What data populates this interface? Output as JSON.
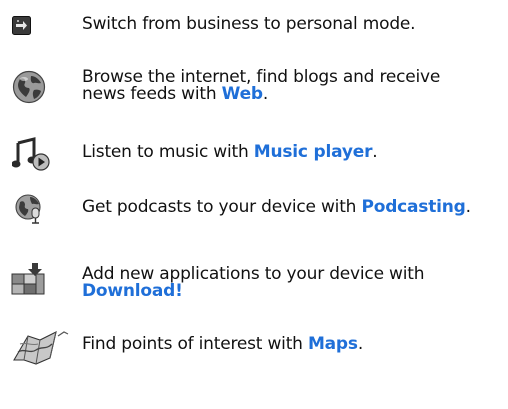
{
  "rows": [
    {
      "icon": "mode-switch-icon",
      "text": "Switch from business to personal mode."
    },
    {
      "icon": "globe-icon",
      "line1": "Browse the internet, find blogs and receive",
      "line2_prefix": "news feeds with ",
      "link": "Web",
      "suffix": "."
    },
    {
      "icon": "music-note-icon",
      "prefix": "Listen to music with ",
      "link": "Music player",
      "suffix": "."
    },
    {
      "icon": "podcast-icon",
      "prefix": "Get podcasts to your device with ",
      "link": "Podcasting",
      "suffix": "."
    },
    {
      "icon": "download-grid-icon",
      "line1": "Add new applications to your device with",
      "link": "Download!"
    },
    {
      "icon": "map-icon",
      "prefix": "Find points of interest with ",
      "link": "Maps",
      "suffix": "."
    }
  ],
  "colors": {
    "link": "#1f6fd8",
    "text": "#111111"
  }
}
